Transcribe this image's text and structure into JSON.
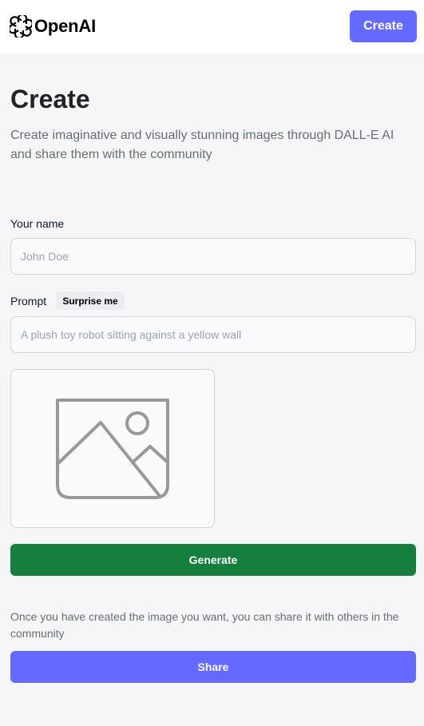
{
  "header": {
    "logo_text": "OpenAI",
    "logo_icon": "openai-logo-icon",
    "create_label": "Create"
  },
  "page": {
    "title": "Create",
    "description": "Create imaginative and visually stunning images through DALL-E AI and share them with the community"
  },
  "form": {
    "name": {
      "label": "Your name",
      "value": "",
      "placeholder": "John Doe"
    },
    "prompt": {
      "label": "Prompt",
      "surprise_label": "Surprise me",
      "value": "",
      "placeholder": "A plush toy robot sitting against a yellow wall"
    },
    "preview_icon": "image-placeholder-icon",
    "generate_label": "Generate"
  },
  "share": {
    "note": "Once you have created the image you want, you can share it with others in the community",
    "button_label": "Share"
  },
  "colors": {
    "accent": "#6469ff",
    "generate_green": "#15803d",
    "page_background": "#f6f6f9",
    "header_background": "#ffffff"
  }
}
